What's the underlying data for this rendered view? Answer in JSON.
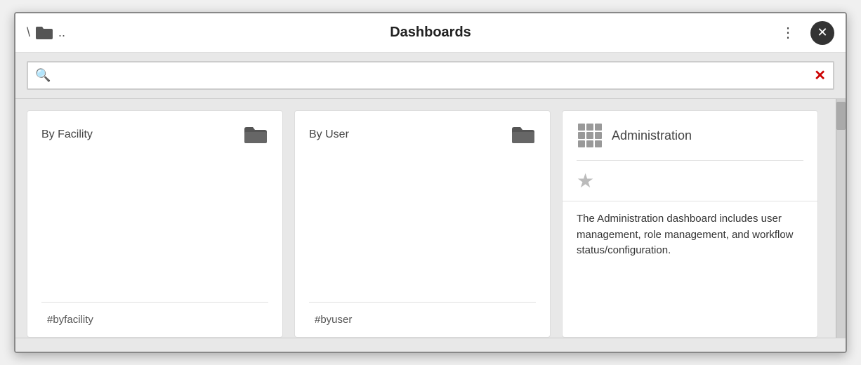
{
  "window": {
    "title": "Dashboards",
    "nav_back": "\\",
    "nav_up": "..",
    "more_icon": "⋮",
    "close_icon": "✕"
  },
  "search": {
    "placeholder": "",
    "clear_icon": "✕"
  },
  "cards": [
    {
      "id": "by-facility",
      "title": "By Facility",
      "tag": "#byfacility",
      "type": "folder"
    },
    {
      "id": "by-user",
      "title": "By User",
      "tag": "#byuser",
      "type": "folder"
    },
    {
      "id": "administration",
      "title": "Administration",
      "description": "The Administration dashboard includes user management, role management, and workflow status/configuration.",
      "type": "app"
    }
  ]
}
